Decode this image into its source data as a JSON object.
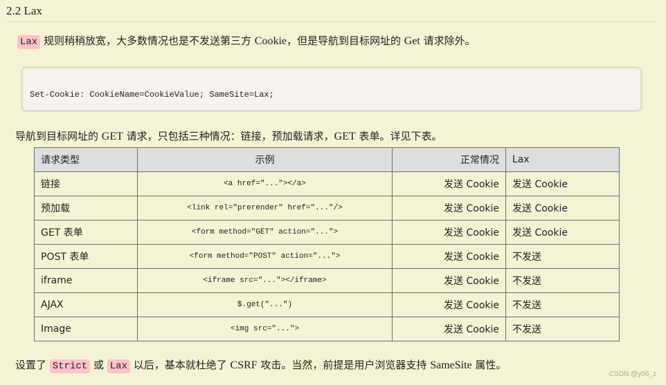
{
  "heading": "2.2 Lax",
  "intro": {
    "chip": "Lax",
    "text_a": " 规则稍稍放宽，大多数情况也是不发送第三方 ",
    "latin_a": "Cookie",
    "text_b": "，但是导航到目标网址的 ",
    "latin_b": "Get",
    "text_c": " 请求除外。"
  },
  "code_block": {
    "code": "Set-Cookie: CookieName=CookieValue; SameSite=Lax;"
  },
  "nav_paragraph": {
    "text_a": "导航到目标网址的 ",
    "latin_a": "GET",
    "text_b": " 请求，只包括三种情况：链接，预加载请求，",
    "latin_b": "GET",
    "text_c": " 表单。详见下表。"
  },
  "table": {
    "headers": [
      "请求类型",
      "示例",
      "正常情况",
      "Lax"
    ],
    "rows": [
      {
        "type": "链接",
        "example": "<a href=\"...\"></a>",
        "normal": "发送 Cookie",
        "lax": "发送 Cookie"
      },
      {
        "type": "预加载",
        "example": "<link rel=\"prerender\" href=\"...\"/>",
        "normal": "发送 Cookie",
        "lax": "发送 Cookie"
      },
      {
        "type": "GET 表单",
        "example": "<form method=\"GET\" action=\"...\">",
        "normal": "发送 Cookie",
        "lax": "发送 Cookie"
      },
      {
        "type": "POST 表单",
        "example": "<form method=\"POST\" action=\"...\">",
        "normal": "发送 Cookie",
        "lax": "不发送"
      },
      {
        "type": "iframe",
        "example": "<iframe src=\"...\"></iframe>",
        "normal": "发送 Cookie",
        "lax": "不发送"
      },
      {
        "type": "AJAX",
        "example": "$.get(\"...\")",
        "normal": "发送 Cookie",
        "lax": "不发送"
      },
      {
        "type": "Image",
        "example": "<img src=\"...\">",
        "normal": "发送 Cookie",
        "lax": "不发送"
      }
    ]
  },
  "conclusion": {
    "text_a": "设置了 ",
    "chip_strict": "Strict",
    "text_b": " 或 ",
    "chip_lax": "Lax",
    "text_c": " 以后，基本就杜绝了 ",
    "latin_a": "CSRF",
    "text_d": " 攻击。当然，前提是用户浏览器支持 ",
    "latin_b": "SameSite",
    "text_e": " 属性。"
  },
  "watermark": "CSDN @y06_z",
  "colors": {
    "background": "#f4f3d4",
    "chip": "#fec0cb",
    "code_bg": "#f5f2f0",
    "table_header_bg": "#dedede"
  }
}
